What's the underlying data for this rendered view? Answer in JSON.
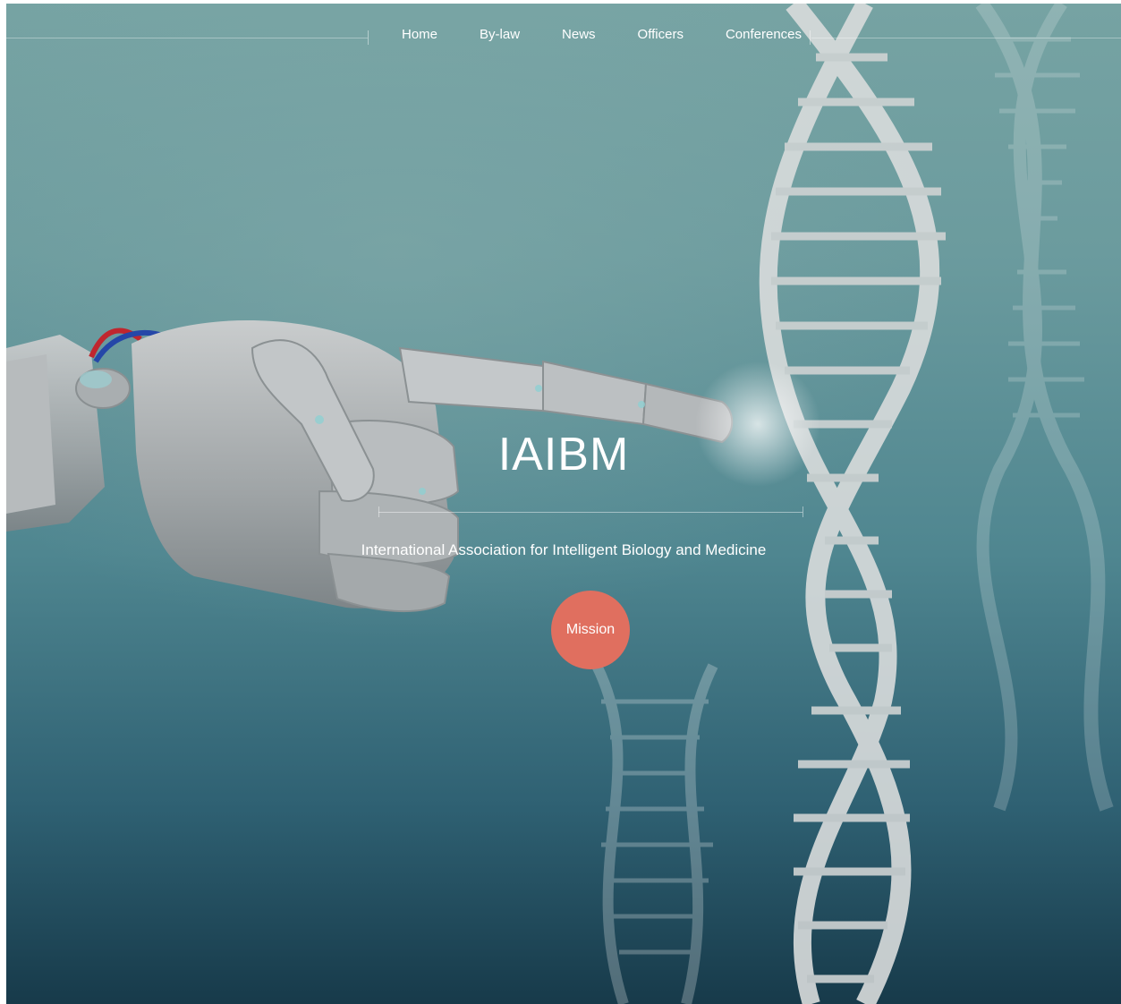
{
  "nav": {
    "items": [
      {
        "label": "Home"
      },
      {
        "label": "By-law"
      },
      {
        "label": "News"
      },
      {
        "label": "Officers"
      },
      {
        "label": "Conferences"
      }
    ]
  },
  "hero": {
    "title": "IAIBM",
    "subtitle": "International Association for Intelligent Biology and Medicine",
    "cta_label": "Mission"
  },
  "colors": {
    "cta": "#e06f5f",
    "background_top": "#76a3a3",
    "background_bottom": "#173a4a"
  }
}
